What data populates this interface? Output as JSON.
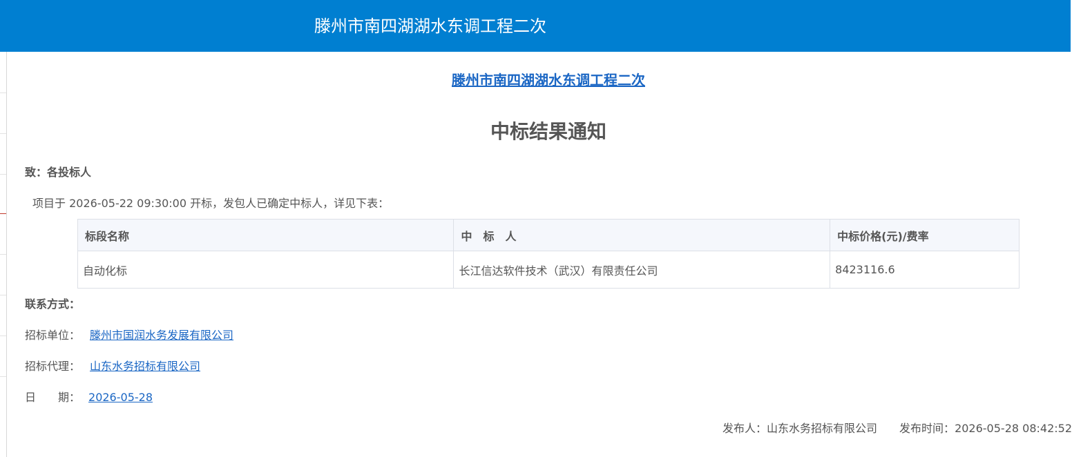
{
  "header": {
    "title": "滕州市南四湖湖水东调工程二次"
  },
  "notice": {
    "project_link": "滕州市南四湖湖水东调工程二次",
    "title": "中标结果通知",
    "to": "致：各投标人",
    "intro": "项目于 2026-05-22 09:30:00 开标，发包人已确定中标人，详见下表："
  },
  "table": {
    "headers": [
      "标段名称",
      "中　标　人",
      "中标价格(元)/费率"
    ],
    "rows": [
      [
        "自动化标",
        "长江信达软件技术（武汉）有限责任公司",
        "8423116.6"
      ]
    ]
  },
  "contact": {
    "heading": "联系方式：",
    "owner_label": "招标单位：",
    "owner_value": "滕州市国润水务发展有限公司",
    "agent_label": "招标代理：",
    "agent_value": "山东水务招标有限公司",
    "date_label": "日　　期：",
    "date_value": "2026-05-28"
  },
  "footer": {
    "publisher_label": "发布人：",
    "publisher_value": "山东水务招标有限公司",
    "time_label": "发布时间：",
    "time_value": "2026-05-28 08:42:52"
  },
  "colors": {
    "header_bg": "#007fd1",
    "link": "#1a66c4",
    "text": "#555555",
    "table_header_bg": "#f5f7fc",
    "table_border": "#dcdfe6"
  }
}
